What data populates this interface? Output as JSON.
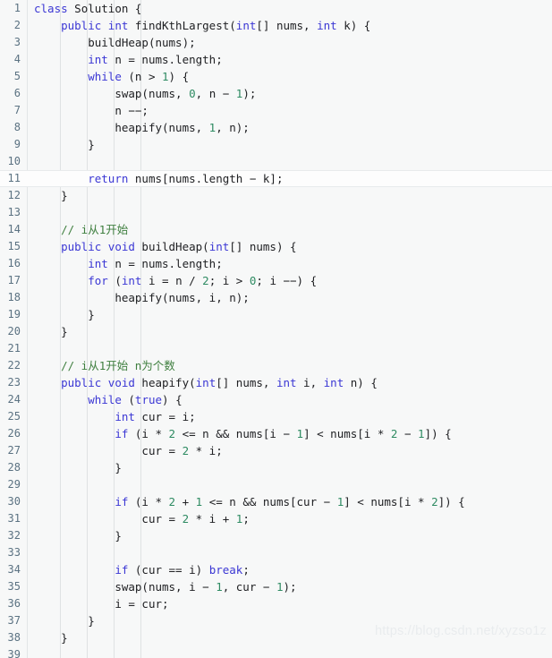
{
  "editor": {
    "language": "java",
    "background_color": "#f7f8f8",
    "line_number_color": "#5b7282",
    "keyword_color": "#3b37d4",
    "number_color": "#2e8b62",
    "comment_color": "#3f7f3f",
    "text_color": "#202124",
    "indent_guide_color": "#dfe2e3",
    "highlighted_line": 11,
    "first_line": 1,
    "last_line": 39,
    "tab_size": 4
  },
  "watermark": {
    "text": "https://blog.csdn.net/xyzso1z",
    "color": "#e9ecee"
  },
  "lines": [
    {
      "n": "1",
      "indent": 0,
      "tokens": [
        {
          "t": "kw",
          "v": "class"
        },
        {
          "t": "txt",
          "v": " Solution {"
        }
      ]
    },
    {
      "n": "2",
      "indent": 1,
      "tokens": [
        {
          "t": "kw",
          "v": "public"
        },
        {
          "t": "txt",
          "v": " "
        },
        {
          "t": "kw",
          "v": "int"
        },
        {
          "t": "txt",
          "v": " findKthLargest("
        },
        {
          "t": "kw",
          "v": "int"
        },
        {
          "t": "txt",
          "v": "[] nums, "
        },
        {
          "t": "kw",
          "v": "int"
        },
        {
          "t": "txt",
          "v": " k) {"
        }
      ]
    },
    {
      "n": "3",
      "indent": 2,
      "tokens": [
        {
          "t": "txt",
          "v": "buildHeap(nums);"
        }
      ]
    },
    {
      "n": "4",
      "indent": 2,
      "tokens": [
        {
          "t": "kw",
          "v": "int"
        },
        {
          "t": "txt",
          "v": " n = nums.length;"
        }
      ]
    },
    {
      "n": "5",
      "indent": 2,
      "tokens": [
        {
          "t": "kw",
          "v": "while"
        },
        {
          "t": "txt",
          "v": " (n > "
        },
        {
          "t": "num",
          "v": "1"
        },
        {
          "t": "txt",
          "v": ") {"
        }
      ]
    },
    {
      "n": "6",
      "indent": 3,
      "tokens": [
        {
          "t": "txt",
          "v": "swap(nums, "
        },
        {
          "t": "num",
          "v": "0"
        },
        {
          "t": "txt",
          "v": ", n − "
        },
        {
          "t": "num",
          "v": "1"
        },
        {
          "t": "txt",
          "v": ");"
        }
      ]
    },
    {
      "n": "7",
      "indent": 3,
      "tokens": [
        {
          "t": "txt",
          "v": "n −−;"
        }
      ]
    },
    {
      "n": "8",
      "indent": 3,
      "tokens": [
        {
          "t": "txt",
          "v": "heapify(nums, "
        },
        {
          "t": "num",
          "v": "1"
        },
        {
          "t": "txt",
          "v": ", n);"
        }
      ]
    },
    {
      "n": "9",
      "indent": 2,
      "tokens": [
        {
          "t": "txt",
          "v": "}"
        }
      ]
    },
    {
      "n": "10",
      "indent": 0,
      "tokens": []
    },
    {
      "n": "11",
      "indent": 2,
      "tokens": [
        {
          "t": "kw",
          "v": "return"
        },
        {
          "t": "txt",
          "v": " nums[nums.length − k];"
        }
      ]
    },
    {
      "n": "12",
      "indent": 1,
      "tokens": [
        {
          "t": "txt",
          "v": "}"
        }
      ]
    },
    {
      "n": "13",
      "indent": 0,
      "tokens": []
    },
    {
      "n": "14",
      "indent": 1,
      "tokens": [
        {
          "t": "com",
          "v": "// i从1开始"
        }
      ]
    },
    {
      "n": "15",
      "indent": 1,
      "tokens": [
        {
          "t": "kw",
          "v": "public"
        },
        {
          "t": "txt",
          "v": " "
        },
        {
          "t": "kw",
          "v": "void"
        },
        {
          "t": "txt",
          "v": " buildHeap("
        },
        {
          "t": "kw",
          "v": "int"
        },
        {
          "t": "txt",
          "v": "[] nums) {"
        }
      ]
    },
    {
      "n": "16",
      "indent": 2,
      "tokens": [
        {
          "t": "kw",
          "v": "int"
        },
        {
          "t": "txt",
          "v": " n = nums.length;"
        }
      ]
    },
    {
      "n": "17",
      "indent": 2,
      "tokens": [
        {
          "t": "kw",
          "v": "for"
        },
        {
          "t": "txt",
          "v": " ("
        },
        {
          "t": "kw",
          "v": "int"
        },
        {
          "t": "txt",
          "v": " i = n / "
        },
        {
          "t": "num",
          "v": "2"
        },
        {
          "t": "txt",
          "v": "; i > "
        },
        {
          "t": "num",
          "v": "0"
        },
        {
          "t": "txt",
          "v": "; i −−) {"
        }
      ]
    },
    {
      "n": "18",
      "indent": 3,
      "tokens": [
        {
          "t": "txt",
          "v": "heapify(nums, i, n);"
        }
      ]
    },
    {
      "n": "19",
      "indent": 2,
      "tokens": [
        {
          "t": "txt",
          "v": "}"
        }
      ]
    },
    {
      "n": "20",
      "indent": 1,
      "tokens": [
        {
          "t": "txt",
          "v": "}"
        }
      ]
    },
    {
      "n": "21",
      "indent": 0,
      "tokens": []
    },
    {
      "n": "22",
      "indent": 1,
      "tokens": [
        {
          "t": "com",
          "v": "// i从1开始 n为个数"
        }
      ]
    },
    {
      "n": "23",
      "indent": 1,
      "tokens": [
        {
          "t": "kw",
          "v": "public"
        },
        {
          "t": "txt",
          "v": " "
        },
        {
          "t": "kw",
          "v": "void"
        },
        {
          "t": "txt",
          "v": " heapify("
        },
        {
          "t": "kw",
          "v": "int"
        },
        {
          "t": "txt",
          "v": "[] nums, "
        },
        {
          "t": "kw",
          "v": "int"
        },
        {
          "t": "txt",
          "v": " i, "
        },
        {
          "t": "kw",
          "v": "int"
        },
        {
          "t": "txt",
          "v": " n) {"
        }
      ]
    },
    {
      "n": "24",
      "indent": 2,
      "tokens": [
        {
          "t": "kw",
          "v": "while"
        },
        {
          "t": "txt",
          "v": " ("
        },
        {
          "t": "kw",
          "v": "true"
        },
        {
          "t": "txt",
          "v": ") {"
        }
      ]
    },
    {
      "n": "25",
      "indent": 3,
      "tokens": [
        {
          "t": "kw",
          "v": "int"
        },
        {
          "t": "txt",
          "v": " cur = i;"
        }
      ]
    },
    {
      "n": "26",
      "indent": 3,
      "tokens": [
        {
          "t": "kw",
          "v": "if"
        },
        {
          "t": "txt",
          "v": " (i * "
        },
        {
          "t": "num",
          "v": "2"
        },
        {
          "t": "txt",
          "v": " <= n && nums[i − "
        },
        {
          "t": "num",
          "v": "1"
        },
        {
          "t": "txt",
          "v": "] < nums[i * "
        },
        {
          "t": "num",
          "v": "2"
        },
        {
          "t": "txt",
          "v": " − "
        },
        {
          "t": "num",
          "v": "1"
        },
        {
          "t": "txt",
          "v": "]) {"
        }
      ]
    },
    {
      "n": "27",
      "indent": 4,
      "tokens": [
        {
          "t": "txt",
          "v": "cur = "
        },
        {
          "t": "num",
          "v": "2"
        },
        {
          "t": "txt",
          "v": " * i;"
        }
      ]
    },
    {
      "n": "28",
      "indent": 3,
      "tokens": [
        {
          "t": "txt",
          "v": "}"
        }
      ]
    },
    {
      "n": "29",
      "indent": 0,
      "tokens": []
    },
    {
      "n": "30",
      "indent": 3,
      "tokens": [
        {
          "t": "kw",
          "v": "if"
        },
        {
          "t": "txt",
          "v": " (i * "
        },
        {
          "t": "num",
          "v": "2"
        },
        {
          "t": "txt",
          "v": " + "
        },
        {
          "t": "num",
          "v": "1"
        },
        {
          "t": "txt",
          "v": " <= n && nums[cur − "
        },
        {
          "t": "num",
          "v": "1"
        },
        {
          "t": "txt",
          "v": "] < nums[i * "
        },
        {
          "t": "num",
          "v": "2"
        },
        {
          "t": "txt",
          "v": "]) {"
        }
      ]
    },
    {
      "n": "31",
      "indent": 4,
      "tokens": [
        {
          "t": "txt",
          "v": "cur = "
        },
        {
          "t": "num",
          "v": "2"
        },
        {
          "t": "txt",
          "v": " * i + "
        },
        {
          "t": "num",
          "v": "1"
        },
        {
          "t": "txt",
          "v": ";"
        }
      ]
    },
    {
      "n": "32",
      "indent": 3,
      "tokens": [
        {
          "t": "txt",
          "v": "}"
        }
      ]
    },
    {
      "n": "33",
      "indent": 0,
      "tokens": []
    },
    {
      "n": "34",
      "indent": 3,
      "tokens": [
        {
          "t": "kw",
          "v": "if"
        },
        {
          "t": "txt",
          "v": " (cur == i) "
        },
        {
          "t": "kw",
          "v": "break"
        },
        {
          "t": "txt",
          "v": ";"
        }
      ]
    },
    {
      "n": "35",
      "indent": 3,
      "tokens": [
        {
          "t": "txt",
          "v": "swap(nums, i − "
        },
        {
          "t": "num",
          "v": "1"
        },
        {
          "t": "txt",
          "v": ", cur − "
        },
        {
          "t": "num",
          "v": "1"
        },
        {
          "t": "txt",
          "v": ");"
        }
      ]
    },
    {
      "n": "36",
      "indent": 3,
      "tokens": [
        {
          "t": "txt",
          "v": "i = cur;"
        }
      ]
    },
    {
      "n": "37",
      "indent": 2,
      "tokens": [
        {
          "t": "txt",
          "v": "}"
        }
      ]
    },
    {
      "n": "38",
      "indent": 1,
      "tokens": [
        {
          "t": "txt",
          "v": "}"
        }
      ]
    },
    {
      "n": "39",
      "indent": 0,
      "tokens": []
    }
  ]
}
